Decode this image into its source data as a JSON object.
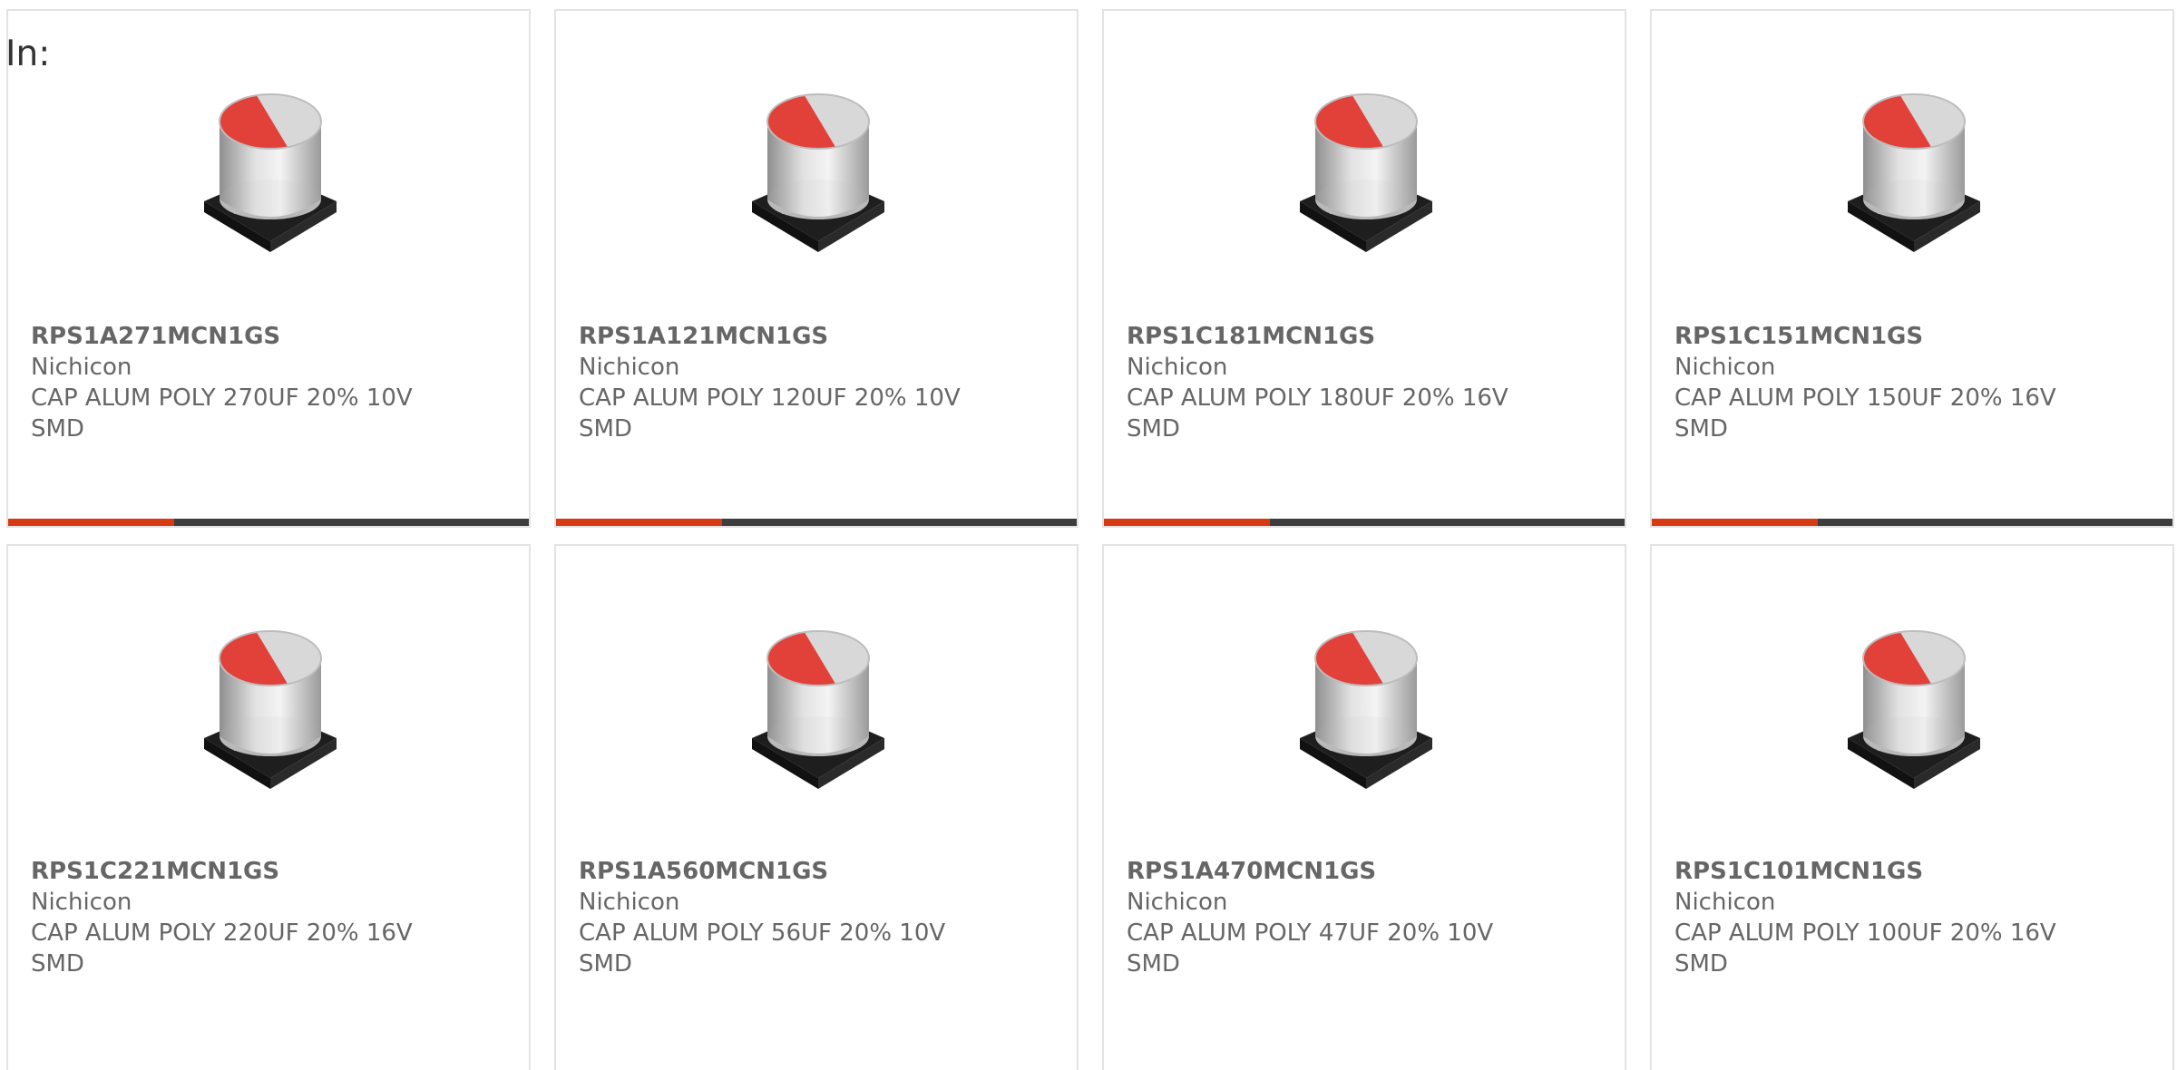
{
  "header": {
    "label": "In:"
  },
  "colors": {
    "accent": "#d63a12",
    "bar": "#3d3d3d",
    "text": "#666666",
    "capacitor_stripe": "#e2413a"
  },
  "products": [
    {
      "part_number": "RPS1A271MCN1GS",
      "manufacturer": "Nichicon",
      "description": "CAP ALUM POLY 270UF 20% 10V",
      "package": "SMD",
      "icon": "capacitor-image"
    },
    {
      "part_number": "RPS1A121MCN1GS",
      "manufacturer": "Nichicon",
      "description": "CAP ALUM POLY 120UF 20% 10V",
      "package": "SMD",
      "icon": "capacitor-image"
    },
    {
      "part_number": "RPS1C181MCN1GS",
      "manufacturer": "Nichicon",
      "description": "CAP ALUM POLY 180UF 20% 16V",
      "package": "SMD",
      "icon": "capacitor-image"
    },
    {
      "part_number": "RPS1C151MCN1GS",
      "manufacturer": "Nichicon",
      "description": "CAP ALUM POLY 150UF 20% 16V",
      "package": "SMD",
      "icon": "capacitor-image"
    },
    {
      "part_number": "RPS1C221MCN1GS",
      "manufacturer": "Nichicon",
      "description": "CAP ALUM POLY 220UF 20% 16V",
      "package": "SMD",
      "icon": "capacitor-image"
    },
    {
      "part_number": "RPS1A560MCN1GS",
      "manufacturer": "Nichicon",
      "description": "CAP ALUM POLY 56UF 20% 10V",
      "package": "SMD",
      "icon": "capacitor-image"
    },
    {
      "part_number": "RPS1A470MCN1GS",
      "manufacturer": "Nichicon",
      "description": "CAP ALUM POLY 47UF 20% 10V",
      "package": "SMD",
      "icon": "capacitor-image"
    },
    {
      "part_number": "RPS1C101MCN1GS",
      "manufacturer": "Nichicon",
      "description": "CAP ALUM POLY 100UF 20% 16V",
      "package": "SMD",
      "icon": "capacitor-image"
    }
  ]
}
